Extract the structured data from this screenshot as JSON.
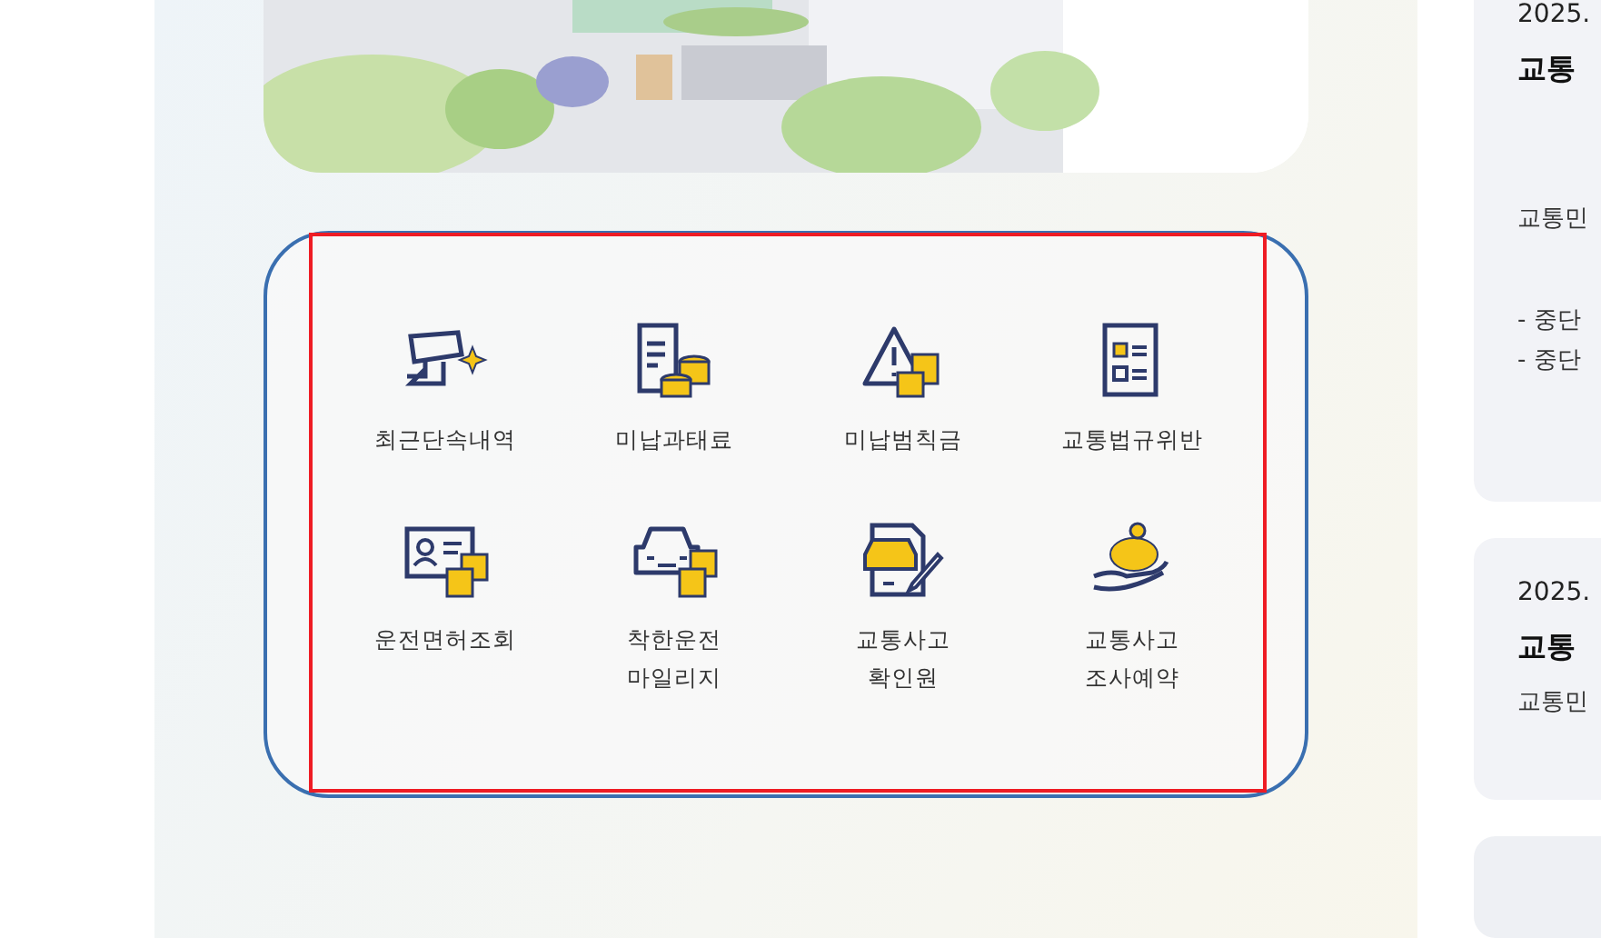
{
  "menu": [
    {
      "label": "최근단속내역"
    },
    {
      "label": "미납과태료"
    },
    {
      "label": "미납범칙금"
    },
    {
      "label": "교통법규위반"
    },
    {
      "label": "운전면허조회"
    },
    {
      "label": "착한운전\n마일리지"
    },
    {
      "label": "교통사고\n확인원"
    },
    {
      "label": "교통사고\n조사예약"
    }
  ],
  "notices": [
    {
      "date": "2025.",
      "title": "교통",
      "body": "교통민",
      "bullets": [
        "- 중단",
        "- 중단"
      ]
    },
    {
      "date": "2025.",
      "title": "교통",
      "body": "교통민"
    }
  ]
}
